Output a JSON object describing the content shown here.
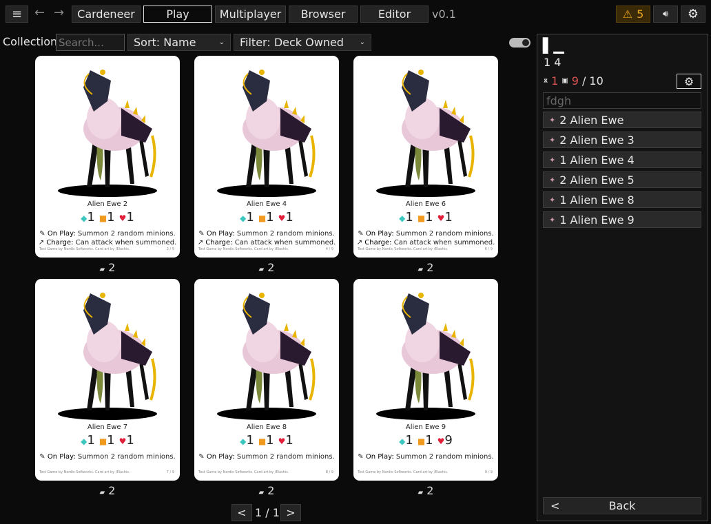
{
  "nav": {
    "menu_icon": "hamburger-icon",
    "back_icon": "arrow-left-icon",
    "forward_icon": "arrow-right-icon",
    "tabs": [
      "Cardeneer",
      "Play",
      "Multiplayer",
      "Browser",
      "Editor"
    ],
    "active_tab": "Play",
    "version": "v0.1"
  },
  "topright": {
    "warning_count": "5",
    "warning_color": "#e8a317",
    "sound_icon": "speaker-icon",
    "settings_icon": "gear-icon"
  },
  "toolbar": {
    "label": "Collection",
    "search_placeholder": "Search...",
    "sort": "Sort: Name",
    "filter": "Filter: Deck Owned",
    "toggle_on": true
  },
  "cards": [
    {
      "name": "Alien Ewe 2",
      "cost": "1",
      "attack": "1",
      "health": "1",
      "abilities": [
        {
          "k": "On Play:",
          "t": " Summon 2 random minions."
        },
        {
          "k": "Charge:",
          "t": " Can attack when summoned."
        }
      ],
      "footer": "Test Game by Nordic Softworks. Card art by /Elashis.",
      "num": "2 / 9",
      "count": "2"
    },
    {
      "name": "Alien Ewe 4",
      "cost": "1",
      "attack": "1",
      "health": "1",
      "abilities": [
        {
          "k": "On Play:",
          "t": " Summon 2 random minions."
        },
        {
          "k": "Charge:",
          "t": " Can attack when summoned."
        }
      ],
      "footer": "Test Game by Nordic Softworks. Card art by /Elashis.",
      "num": "4 / 9",
      "count": "2"
    },
    {
      "name": "Alien Ewe 6",
      "cost": "1",
      "attack": "1",
      "health": "1",
      "abilities": [
        {
          "k": "On Play:",
          "t": " Summon 2 random minions."
        },
        {
          "k": "Charge:",
          "t": " Can attack when summoned."
        }
      ],
      "footer": "Test Game by Nordic Softworks. Card art by /Elashis.",
      "num": "6 / 9",
      "count": "2"
    },
    {
      "name": "Alien Ewe 7",
      "cost": "1",
      "attack": "1",
      "health": "1",
      "abilities": [
        {
          "k": "On Play:",
          "t": " Summon 2 random minions."
        }
      ],
      "footer": "Test Game by Nordic Softworks. Card art by /Elashis.",
      "num": "7 / 9",
      "count": "2"
    },
    {
      "name": "Alien Ewe 8",
      "cost": "1",
      "attack": "1",
      "health": "1",
      "abilities": [
        {
          "k": "On Play:",
          "t": " Summon 2 random minions."
        }
      ],
      "footer": "Test Game by Nordic Softworks. Card art by /Elashis.",
      "num": "8 / 9",
      "count": "2"
    },
    {
      "name": "Alien Ewe 9",
      "cost": "1",
      "attack": "1",
      "health": "9",
      "abilities": [
        {
          "k": "On Play:",
          "t": " Summon 2 random minions."
        }
      ],
      "footer": "Test Game by Nordic Softworks. Card art by /Elashis.",
      "num": "9 / 9",
      "count": "2"
    }
  ],
  "pagination": {
    "prev": "<",
    "page": "1 / 1",
    "next": ">"
  },
  "deck": {
    "title_glyph": "▌▁",
    "subtitle": "1 4",
    "creatures": "1",
    "spells": "9",
    "total": "/ 10",
    "name_value": "fdgh",
    "items": [
      "2 Alien Ewe",
      "2 Alien Ewe 3",
      "1 Alien Ewe 4",
      "2 Alien Ewe 5",
      "1 Alien Ewe 8",
      "1 Alien Ewe 9"
    ],
    "back": "Back"
  }
}
